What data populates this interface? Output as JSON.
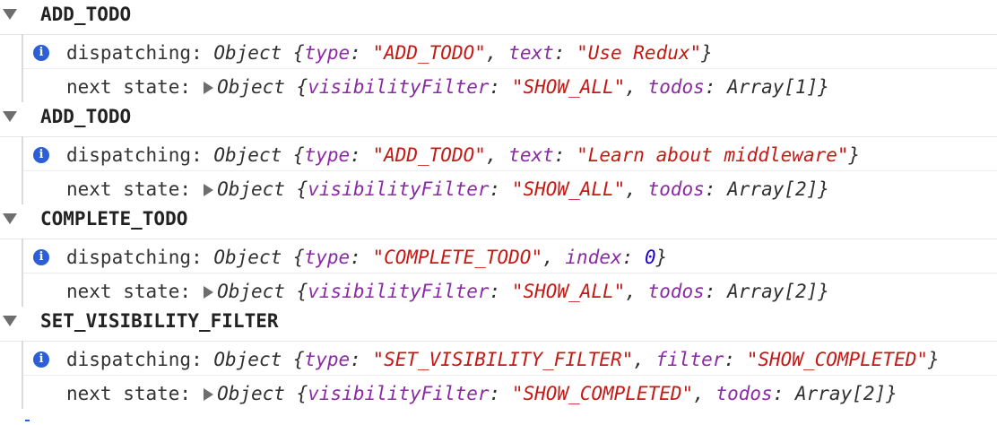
{
  "colors": {
    "info_icon": "#2c5fd6",
    "key": "#8a2aa4",
    "string": "#c41a16",
    "number": "#1c00cf"
  },
  "icons": {
    "group_toggle": "triangle-down-icon",
    "info": "info-icon",
    "expand": "triangle-right-icon"
  },
  "info_glyph": "i",
  "groups": [
    {
      "title": "ADD_TODO",
      "dispatch": {
        "label": "dispatching:",
        "object_word": "Object",
        "open": "{",
        "type_key": "type",
        "colon1": ":",
        "type_value": "\"ADD_TODO\"",
        "comma": ",",
        "second_key": "text",
        "colon2": ":",
        "second_value": "\"Use Redux\"",
        "close": "}"
      },
      "next": {
        "label": "next state:",
        "object_word": "Object",
        "open": "{",
        "filter_key": "visibilityFilter",
        "colon1": ":",
        "filter_value": "\"SHOW_ALL\"",
        "comma": ",",
        "todos_key": "todos",
        "colon2": ":",
        "todos_value": "Array[1]",
        "close": "}"
      }
    },
    {
      "title": "ADD_TODO",
      "dispatch": {
        "label": "dispatching:",
        "object_word": "Object",
        "open": "{",
        "type_key": "type",
        "colon1": ":",
        "type_value": "\"ADD_TODO\"",
        "comma": ",",
        "second_key": "text",
        "colon2": ":",
        "second_value": "\"Learn about middleware\"",
        "close": "}"
      },
      "next": {
        "label": "next state:",
        "object_word": "Object",
        "open": "{",
        "filter_key": "visibilityFilter",
        "colon1": ":",
        "filter_value": "\"SHOW_ALL\"",
        "comma": ",",
        "todos_key": "todos",
        "colon2": ":",
        "todos_value": "Array[2]",
        "close": "}"
      }
    },
    {
      "title": "COMPLETE_TODO",
      "dispatch": {
        "label": "dispatching:",
        "object_word": "Object",
        "open": "{",
        "type_key": "type",
        "colon1": ":",
        "type_value": "\"COMPLETE_TODO\"",
        "comma": ",",
        "second_key": "index",
        "colon2": ":",
        "second_value": "0",
        "close": "}"
      },
      "next": {
        "label": "next state:",
        "object_word": "Object",
        "open": "{",
        "filter_key": "visibilityFilter",
        "colon1": ":",
        "filter_value": "\"SHOW_ALL\"",
        "comma": ",",
        "todos_key": "todos",
        "colon2": ":",
        "todos_value": "Array[2]",
        "close": "}"
      }
    },
    {
      "title": "SET_VISIBILITY_FILTER",
      "dispatch": {
        "label": "dispatching:",
        "object_word": "Object",
        "open": "{",
        "type_key": "type",
        "colon1": ":",
        "type_value": "\"SET_VISIBILITY_FILTER\"",
        "comma": ",",
        "second_key": "filter",
        "colon2": ":",
        "second_value": "\"SHOW_COMPLETED\"",
        "close": "}"
      },
      "next": {
        "label": "next state:",
        "object_word": "Object",
        "open": "{",
        "filter_key": "visibilityFilter",
        "colon1": ":",
        "filter_value": "\"SHOW_COMPLETED\"",
        "comma": ",",
        "todos_key": "todos",
        "colon2": ":",
        "todos_value": "Array[2]",
        "close": "}"
      }
    }
  ]
}
